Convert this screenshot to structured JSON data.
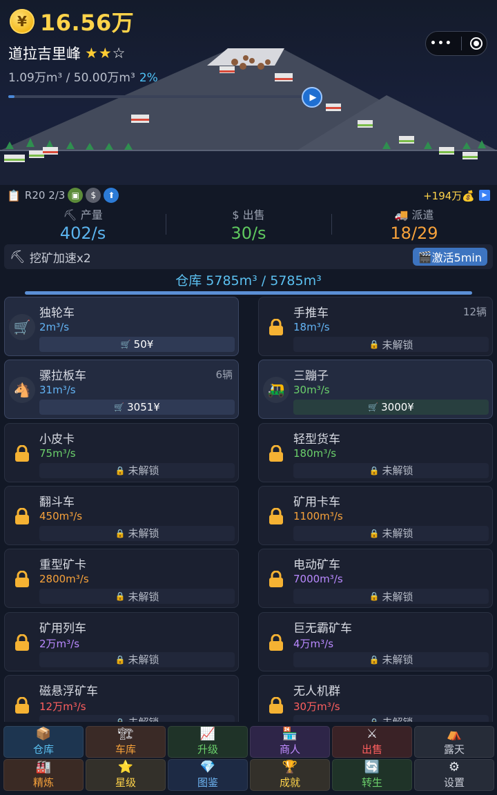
{
  "header": {
    "currency_symbol": "¥",
    "money": "16.56万",
    "mine_name": "道拉吉里峰",
    "stars_on": "★★",
    "stars_off": "☆",
    "progress_text": "1.09万m³ / 50.00万m³",
    "progress_pct": "2%",
    "progress_fraction": 0.02
  },
  "info": {
    "round": "R20 2/3",
    "gain": "+194万💰"
  },
  "stats": {
    "production_label": "产量",
    "production_value": "402/s",
    "sell_label": "出售",
    "sell_value": "30/s",
    "dispatch_label": "派遣",
    "dispatch_value": "18/29"
  },
  "boost": {
    "label": "挖矿加速x2",
    "button": "激活5min"
  },
  "warehouse": {
    "text": "仓库 5785m³ / 5785m³",
    "fill_fraction": 1.0
  },
  "vehicles": [
    {
      "name": "独轮车",
      "rate": "2m³/s",
      "count": "",
      "button": "50¥",
      "state": "active",
      "icon": "cart-icon",
      "glyph": "🛒",
      "rate_color": "blue"
    },
    {
      "name": "手推车",
      "rate": "18m³/s",
      "count": "12辆",
      "button": "未解锁",
      "state": "locked",
      "icon": "lock-icon",
      "rate_color": "blue"
    },
    {
      "name": "骡拉板车",
      "rate": "31m³/s",
      "count": "6辆",
      "button": "3051¥",
      "state": "active",
      "icon": "horse-icon",
      "glyph": "🐴",
      "rate_color": "blue"
    },
    {
      "name": "三蹦子",
      "rate": "30m³/s",
      "count": "",
      "button": "3000¥",
      "state": "active-green",
      "icon": "tuktuk-icon",
      "glyph": "🛺",
      "rate_color": "green"
    },
    {
      "name": "小皮卡",
      "rate": "75m³/s",
      "count": "",
      "button": "未解锁",
      "state": "locked",
      "icon": "lock-icon",
      "rate_color": "green"
    },
    {
      "name": "轻型货车",
      "rate": "180m³/s",
      "count": "",
      "button": "未解锁",
      "state": "locked",
      "icon": "lock-icon",
      "rate_color": "green"
    },
    {
      "name": "翻斗车",
      "rate": "450m³/s",
      "count": "",
      "button": "未解锁",
      "state": "locked",
      "icon": "lock-icon",
      "rate_color": "orange"
    },
    {
      "name": "矿用卡车",
      "rate": "1100m³/s",
      "count": "",
      "button": "未解锁",
      "state": "locked",
      "icon": "lock-icon",
      "rate_color": "orange"
    },
    {
      "name": "重型矿卡",
      "rate": "2800m³/s",
      "count": "",
      "button": "未解锁",
      "state": "locked",
      "icon": "lock-icon",
      "rate_color": "orange"
    },
    {
      "name": "电动矿车",
      "rate": "7000m³/s",
      "count": "",
      "button": "未解锁",
      "state": "locked",
      "icon": "lock-icon",
      "rate_color": "purple"
    },
    {
      "name": "矿用列车",
      "rate": "2万m³/s",
      "count": "",
      "button": "未解锁",
      "state": "locked",
      "icon": "lock-icon",
      "rate_color": "purple"
    },
    {
      "name": "巨无霸矿车",
      "rate": "4万m³/s",
      "count": "",
      "button": "未解锁",
      "state": "locked",
      "icon": "lock-icon",
      "rate_color": "purple"
    },
    {
      "name": "磁悬浮矿车",
      "rate": "12万m³/s",
      "count": "",
      "button": "未解锁",
      "state": "locked",
      "icon": "lock-icon",
      "rate_color": "red"
    },
    {
      "name": "无人机群",
      "rate": "30万m³/s",
      "count": "",
      "button": "未解锁",
      "state": "locked",
      "icon": "lock-icon",
      "rate_color": "red"
    }
  ],
  "nav": [
    {
      "label": "仓库",
      "icon": "box-icon",
      "glyph": "📦",
      "bg": "#1d3550",
      "color": "#5bc0f0"
    },
    {
      "label": "车库",
      "icon": "garage-icon",
      "glyph": "🏗",
      "bg": "#3a2a26",
      "color": "#f7a23b"
    },
    {
      "label": "升级",
      "icon": "chart-up-icon",
      "glyph": "📈",
      "bg": "#1f3328",
      "color": "#6bd06b"
    },
    {
      "label": "商人",
      "icon": "shop-icon",
      "glyph": "🏪",
      "bg": "#2e2548",
      "color": "#c08cff"
    },
    {
      "label": "出售",
      "icon": "swords-icon",
      "glyph": "⚔",
      "bg": "#3a2226",
      "color": "#ff5f5f"
    },
    {
      "label": "露天",
      "icon": "camp-icon",
      "glyph": "⛺",
      "bg": "#262c38",
      "color": "#c8ccd6"
    },
    {
      "label": "精炼",
      "icon": "factory-icon",
      "glyph": "🏭",
      "bg": "#3a2a24",
      "color": "#f7a23b"
    },
    {
      "label": "星级",
      "icon": "star-icon",
      "glyph": "⭐",
      "bg": "#33302a",
      "color": "#ffd34a"
    },
    {
      "label": "图鉴",
      "icon": "gem-icon",
      "glyph": "💎",
      "bg": "#1d2a44",
      "color": "#6fb6f5"
    },
    {
      "label": "成就",
      "icon": "trophy-icon",
      "glyph": "🏆",
      "bg": "#33302a",
      "color": "#ffd34a"
    },
    {
      "label": "转生",
      "icon": "refresh-icon",
      "glyph": "🔄",
      "bg": "#1f3328",
      "color": "#6bd06b"
    },
    {
      "label": "设置",
      "icon": "gear-icon",
      "glyph": "⚙",
      "bg": "#262c38",
      "color": "#c8ccd6"
    }
  ]
}
